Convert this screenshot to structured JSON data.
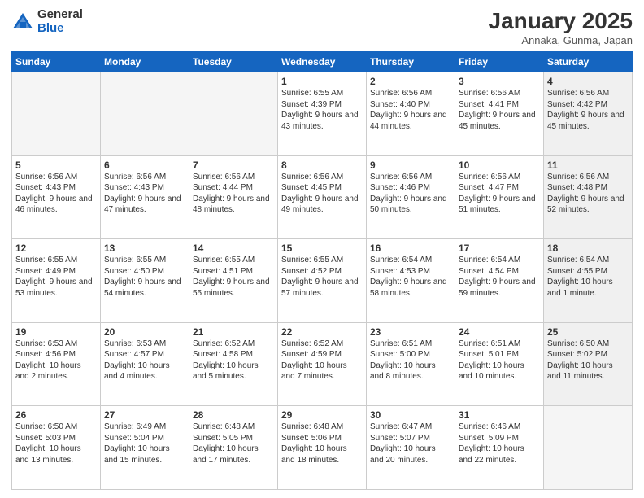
{
  "logo": {
    "general": "General",
    "blue": "Blue"
  },
  "title": "January 2025",
  "location": "Annaka, Gunma, Japan",
  "weekdays": [
    "Sunday",
    "Monday",
    "Tuesday",
    "Wednesday",
    "Thursday",
    "Friday",
    "Saturday"
  ],
  "weeks": [
    [
      {
        "day": "",
        "info": "",
        "empty": true
      },
      {
        "day": "",
        "info": "",
        "empty": true
      },
      {
        "day": "",
        "info": "",
        "empty": true
      },
      {
        "day": "1",
        "info": "Sunrise: 6:55 AM\nSunset: 4:39 PM\nDaylight: 9 hours and 43 minutes.",
        "empty": false
      },
      {
        "day": "2",
        "info": "Sunrise: 6:56 AM\nSunset: 4:40 PM\nDaylight: 9 hours and 44 minutes.",
        "empty": false
      },
      {
        "day": "3",
        "info": "Sunrise: 6:56 AM\nSunset: 4:41 PM\nDaylight: 9 hours and 45 minutes.",
        "empty": false
      },
      {
        "day": "4",
        "info": "Sunrise: 6:56 AM\nSunset: 4:42 PM\nDaylight: 9 hours and 45 minutes.",
        "empty": false,
        "shaded": true
      }
    ],
    [
      {
        "day": "5",
        "info": "Sunrise: 6:56 AM\nSunset: 4:43 PM\nDaylight: 9 hours and 46 minutes.",
        "empty": false
      },
      {
        "day": "6",
        "info": "Sunrise: 6:56 AM\nSunset: 4:43 PM\nDaylight: 9 hours and 47 minutes.",
        "empty": false
      },
      {
        "day": "7",
        "info": "Sunrise: 6:56 AM\nSunset: 4:44 PM\nDaylight: 9 hours and 48 minutes.",
        "empty": false
      },
      {
        "day": "8",
        "info": "Sunrise: 6:56 AM\nSunset: 4:45 PM\nDaylight: 9 hours and 49 minutes.",
        "empty": false
      },
      {
        "day": "9",
        "info": "Sunrise: 6:56 AM\nSunset: 4:46 PM\nDaylight: 9 hours and 50 minutes.",
        "empty": false
      },
      {
        "day": "10",
        "info": "Sunrise: 6:56 AM\nSunset: 4:47 PM\nDaylight: 9 hours and 51 minutes.",
        "empty": false
      },
      {
        "day": "11",
        "info": "Sunrise: 6:56 AM\nSunset: 4:48 PM\nDaylight: 9 hours and 52 minutes.",
        "empty": false,
        "shaded": true
      }
    ],
    [
      {
        "day": "12",
        "info": "Sunrise: 6:55 AM\nSunset: 4:49 PM\nDaylight: 9 hours and 53 minutes.",
        "empty": false
      },
      {
        "day": "13",
        "info": "Sunrise: 6:55 AM\nSunset: 4:50 PM\nDaylight: 9 hours and 54 minutes.",
        "empty": false
      },
      {
        "day": "14",
        "info": "Sunrise: 6:55 AM\nSunset: 4:51 PM\nDaylight: 9 hours and 55 minutes.",
        "empty": false
      },
      {
        "day": "15",
        "info": "Sunrise: 6:55 AM\nSunset: 4:52 PM\nDaylight: 9 hours and 57 minutes.",
        "empty": false
      },
      {
        "day": "16",
        "info": "Sunrise: 6:54 AM\nSunset: 4:53 PM\nDaylight: 9 hours and 58 minutes.",
        "empty": false
      },
      {
        "day": "17",
        "info": "Sunrise: 6:54 AM\nSunset: 4:54 PM\nDaylight: 9 hours and 59 minutes.",
        "empty": false
      },
      {
        "day": "18",
        "info": "Sunrise: 6:54 AM\nSunset: 4:55 PM\nDaylight: 10 hours and 1 minute.",
        "empty": false,
        "shaded": true
      }
    ],
    [
      {
        "day": "19",
        "info": "Sunrise: 6:53 AM\nSunset: 4:56 PM\nDaylight: 10 hours and 2 minutes.",
        "empty": false
      },
      {
        "day": "20",
        "info": "Sunrise: 6:53 AM\nSunset: 4:57 PM\nDaylight: 10 hours and 4 minutes.",
        "empty": false
      },
      {
        "day": "21",
        "info": "Sunrise: 6:52 AM\nSunset: 4:58 PM\nDaylight: 10 hours and 5 minutes.",
        "empty": false
      },
      {
        "day": "22",
        "info": "Sunrise: 6:52 AM\nSunset: 4:59 PM\nDaylight: 10 hours and 7 minutes.",
        "empty": false
      },
      {
        "day": "23",
        "info": "Sunrise: 6:51 AM\nSunset: 5:00 PM\nDaylight: 10 hours and 8 minutes.",
        "empty": false
      },
      {
        "day": "24",
        "info": "Sunrise: 6:51 AM\nSunset: 5:01 PM\nDaylight: 10 hours and 10 minutes.",
        "empty": false
      },
      {
        "day": "25",
        "info": "Sunrise: 6:50 AM\nSunset: 5:02 PM\nDaylight: 10 hours and 11 minutes.",
        "empty": false,
        "shaded": true
      }
    ],
    [
      {
        "day": "26",
        "info": "Sunrise: 6:50 AM\nSunset: 5:03 PM\nDaylight: 10 hours and 13 minutes.",
        "empty": false
      },
      {
        "day": "27",
        "info": "Sunrise: 6:49 AM\nSunset: 5:04 PM\nDaylight: 10 hours and 15 minutes.",
        "empty": false
      },
      {
        "day": "28",
        "info": "Sunrise: 6:48 AM\nSunset: 5:05 PM\nDaylight: 10 hours and 17 minutes.",
        "empty": false
      },
      {
        "day": "29",
        "info": "Sunrise: 6:48 AM\nSunset: 5:06 PM\nDaylight: 10 hours and 18 minutes.",
        "empty": false
      },
      {
        "day": "30",
        "info": "Sunrise: 6:47 AM\nSunset: 5:07 PM\nDaylight: 10 hours and 20 minutes.",
        "empty": false
      },
      {
        "day": "31",
        "info": "Sunrise: 6:46 AM\nSunset: 5:09 PM\nDaylight: 10 hours and 22 minutes.",
        "empty": false
      },
      {
        "day": "",
        "info": "",
        "empty": true,
        "shaded": true
      }
    ]
  ]
}
